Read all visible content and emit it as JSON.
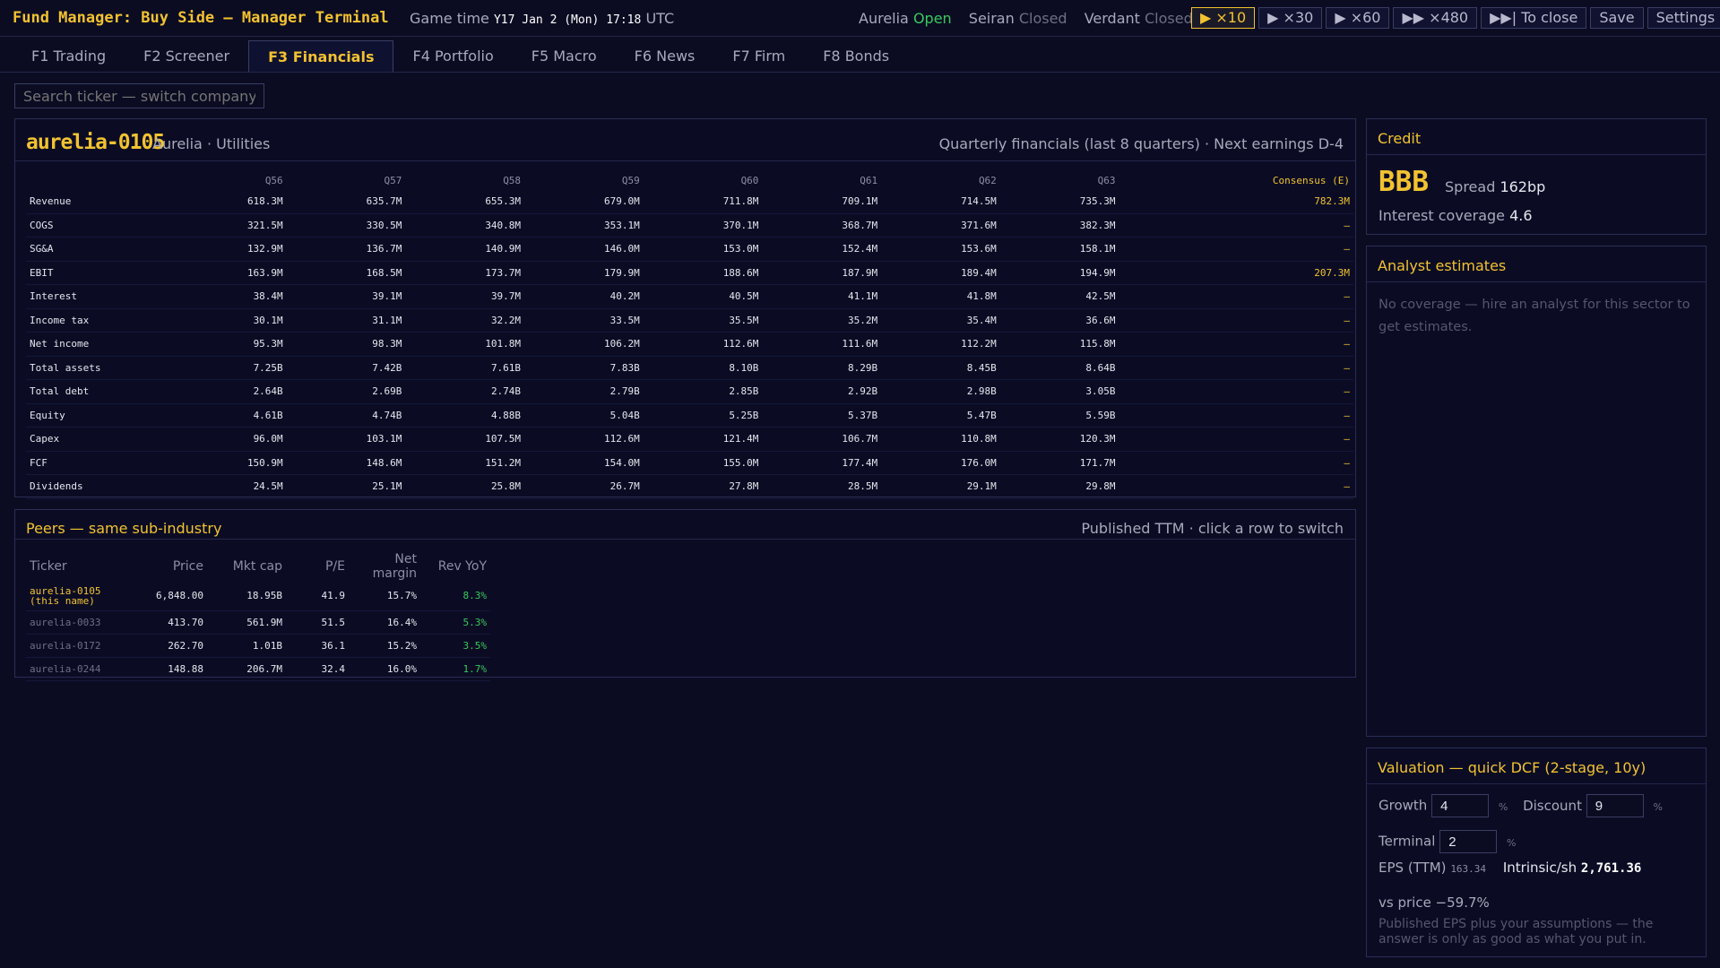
{
  "app": {
    "title": "Fund Manager: Buy Side — Manager Terminal",
    "game_time_label": "Game time",
    "game_time_value": "Y17 Jan 2 (Mon) 17:18",
    "game_time_tz": "UTC"
  },
  "markets": [
    {
      "name": "Aurelia",
      "status": "Open"
    },
    {
      "name": "Seiran",
      "status": "Closed"
    },
    {
      "name": "Verdant",
      "status": "Closed"
    }
  ],
  "controls": {
    "x10": "▶ ×10",
    "x30": "▶ ×30",
    "x60": "▶ ×60",
    "x480": "▶▶ ×480",
    "to_close": "▶▶| To close",
    "save": "Save",
    "settings": "Settings"
  },
  "tabs": [
    "F1 Trading",
    "F2 Screener",
    "F3 Financials",
    "F4 Portfolio",
    "F5 Macro",
    "F6 News",
    "F7 Firm",
    "F8 Bonds"
  ],
  "search": {
    "placeholder": "Search ticker — switch company"
  },
  "company": {
    "ticker": "aurelia-0105",
    "sub": "Aurelia · Utilities",
    "note": "Quarterly financials (last 8 quarters) · Next earnings D-4"
  },
  "financials": {
    "columns": [
      "Q56",
      "Q57",
      "Q58",
      "Q59",
      "Q60",
      "Q61",
      "Q62",
      "Q63",
      "Consensus (E)"
    ],
    "rows": [
      {
        "label": "Revenue",
        "values": [
          "618.3M",
          "635.7M",
          "655.3M",
          "679.0M",
          "711.8M",
          "709.1M",
          "714.5M",
          "735.3M",
          "782.3M"
        ]
      },
      {
        "label": "COGS",
        "values": [
          "321.5M",
          "330.5M",
          "340.8M",
          "353.1M",
          "370.1M",
          "368.7M",
          "371.6M",
          "382.3M",
          "—"
        ]
      },
      {
        "label": "SG&A",
        "values": [
          "132.9M",
          "136.7M",
          "140.9M",
          "146.0M",
          "153.0M",
          "152.4M",
          "153.6M",
          "158.1M",
          "—"
        ]
      },
      {
        "label": "EBIT",
        "values": [
          "163.9M",
          "168.5M",
          "173.7M",
          "179.9M",
          "188.6M",
          "187.9M",
          "189.4M",
          "194.9M",
          "207.3M"
        ]
      },
      {
        "label": "Interest",
        "values": [
          "38.4M",
          "39.1M",
          "39.7M",
          "40.2M",
          "40.5M",
          "41.1M",
          "41.8M",
          "42.5M",
          "—"
        ]
      },
      {
        "label": "Income tax",
        "values": [
          "30.1M",
          "31.1M",
          "32.2M",
          "33.5M",
          "35.5M",
          "35.2M",
          "35.4M",
          "36.6M",
          "—"
        ]
      },
      {
        "label": "Net income",
        "values": [
          "95.3M",
          "98.3M",
          "101.8M",
          "106.2M",
          "112.6M",
          "111.6M",
          "112.2M",
          "115.8M",
          "—"
        ]
      },
      {
        "label": "Total assets",
        "values": [
          "7.25B",
          "7.42B",
          "7.61B",
          "7.83B",
          "8.10B",
          "8.29B",
          "8.45B",
          "8.64B",
          "—"
        ]
      },
      {
        "label": "Total debt",
        "values": [
          "2.64B",
          "2.69B",
          "2.74B",
          "2.79B",
          "2.85B",
          "2.92B",
          "2.98B",
          "3.05B",
          "—"
        ]
      },
      {
        "label": "Equity",
        "values": [
          "4.61B",
          "4.74B",
          "4.88B",
          "5.04B",
          "5.25B",
          "5.37B",
          "5.47B",
          "5.59B",
          "—"
        ]
      },
      {
        "label": "Capex",
        "values": [
          "96.0M",
          "103.1M",
          "107.5M",
          "112.6M",
          "121.4M",
          "106.7M",
          "110.8M",
          "120.3M",
          "—"
        ]
      },
      {
        "label": "FCF",
        "values": [
          "150.9M",
          "148.6M",
          "151.2M",
          "154.0M",
          "155.0M",
          "177.4M",
          "176.0M",
          "171.7M",
          "—"
        ]
      },
      {
        "label": "Dividends",
        "values": [
          "24.5M",
          "25.1M",
          "25.8M",
          "26.7M",
          "27.8M",
          "28.5M",
          "29.1M",
          "29.8M",
          "—"
        ]
      }
    ]
  },
  "peers": {
    "title": "Peers — same sub-industry",
    "note": "Published TTM · click a row to switch",
    "headers": [
      "Ticker",
      "Price",
      "Mkt cap",
      "P/E",
      "Net margin",
      "Rev YoY"
    ],
    "rows": [
      {
        "ticker": "aurelia-0105",
        "sub": "(this name)",
        "price": "6,848.00",
        "mktcap": "18.95B",
        "pe": "41.9",
        "margin": "15.7%",
        "yoy": "8.3%"
      },
      {
        "ticker": "aurelia-0033",
        "sub": "",
        "price": "413.70",
        "mktcap": "561.9M",
        "pe": "51.5",
        "margin": "16.4%",
        "yoy": "5.3%"
      },
      {
        "ticker": "aurelia-0172",
        "sub": "",
        "price": "262.70",
        "mktcap": "1.01B",
        "pe": "36.1",
        "margin": "15.2%",
        "yoy": "3.5%"
      },
      {
        "ticker": "aurelia-0244",
        "sub": "",
        "price": "148.88",
        "mktcap": "206.7M",
        "pe": "32.4",
        "margin": "16.0%",
        "yoy": "1.7%"
      }
    ]
  },
  "credit": {
    "title": "Credit",
    "rating": "BBB",
    "spread_label": "Spread",
    "spread_value": "162bp",
    "coverage_label": "Interest coverage",
    "coverage_value": "4.6"
  },
  "analyst": {
    "title": "Analyst estimates",
    "note": "No coverage — hire an analyst for this sector to get estimates."
  },
  "valuation": {
    "title": "Valuation — quick DCF (2-stage, 10y)",
    "growth_label": "Growth",
    "growth_value": "4",
    "discount_label": "Discount",
    "discount_value": "9",
    "terminal_label": "Terminal",
    "terminal_value": "2",
    "pct": "%",
    "eps_label": "EPS (TTM)",
    "eps_value": "163.34",
    "intrinsic_label": "Intrinsic/sh",
    "intrinsic_value": "2,761.36",
    "vs_price": "vs price −59.7%",
    "note": "Published EPS plus your assumptions — the answer is only as good as what you put in."
  },
  "colors": {
    "accent": "#f2c230",
    "positive": "#38c95c",
    "negative": "#f03e4a",
    "background": "#0b0c22"
  }
}
